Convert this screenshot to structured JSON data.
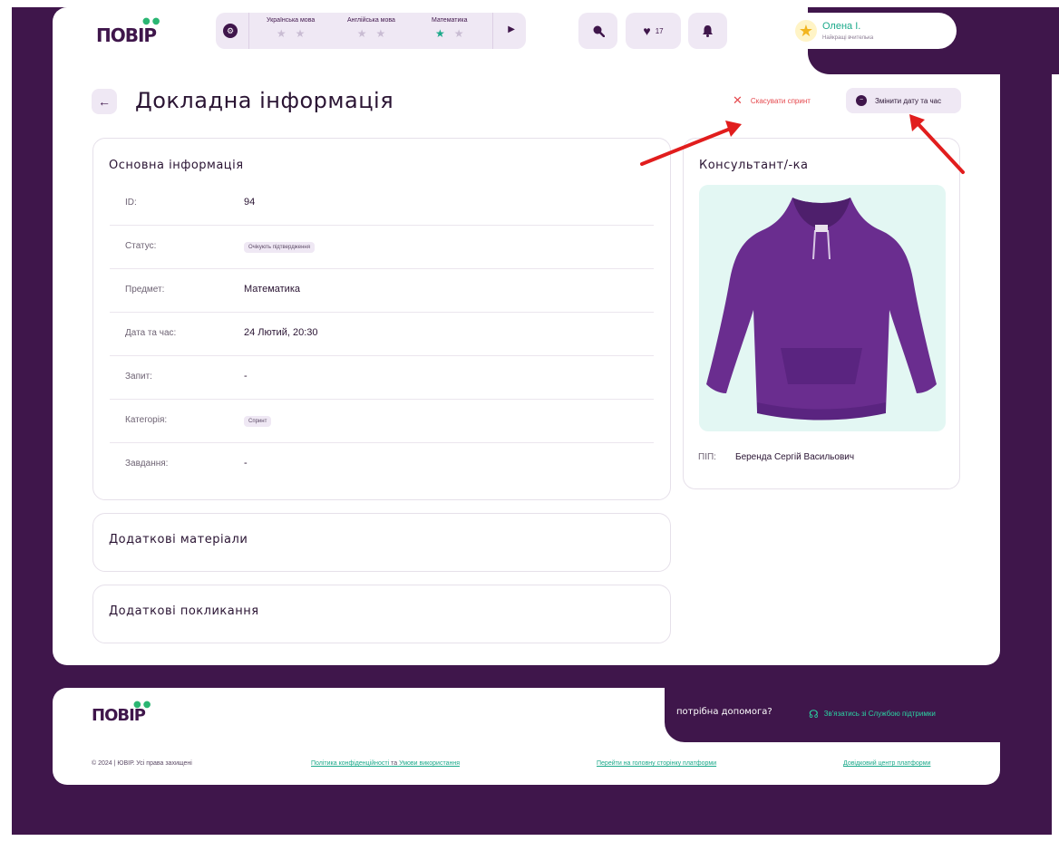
{
  "header": {
    "logo": "ПОВІР",
    "subjects": [
      {
        "name": "Українська мова",
        "stars_filled": 0
      },
      {
        "name": "Англійська мова",
        "stars_filled": 0
      },
      {
        "name": "Математика",
        "stars_filled": 1
      }
    ],
    "favorites_count": "17",
    "user": {
      "name": "Олена І.",
      "role": "Найкращі вчителька"
    }
  },
  "page": {
    "title": "Докладна інформація",
    "cancel_label": "Скасувати спринт",
    "change_label": "Змінити дату та час"
  },
  "basic_info": {
    "title": "Основна інформація",
    "rows": [
      {
        "label": "ID:",
        "value": "94"
      },
      {
        "label": "Статус:",
        "value": "Очікують підтвердження"
      },
      {
        "label": "Предмет:",
        "value": "Математика"
      },
      {
        "label": "Дата та час:",
        "value": "24 Лютий, 20:30"
      },
      {
        "label": "Запит:",
        "value": "-"
      },
      {
        "label": "Категорія:",
        "value": "Спринт"
      },
      {
        "label": "Завдання:",
        "value": "-"
      }
    ]
  },
  "materials": {
    "title": "Додаткові матеріали"
  },
  "links": {
    "title": "Додаткові покликання"
  },
  "consultant": {
    "title": "Консультант/-ка",
    "fio_label": "ПІП:",
    "fio_value": "Беренда Сергій Васильович"
  },
  "footer": {
    "logo": "ПОВІР",
    "help": "потрібна допомога?",
    "support": "Зв'язатись зі Службою підтримки",
    "copyright": "© 2024 | ЮВІР. Усі права захищені",
    "privacy": "Політика конфіденційності",
    "and": "та",
    "terms": "Умови використання",
    "home": "Перейти на головну сторінку платформи",
    "help_center": "Довідковий центр платформи"
  },
  "colors": {
    "brand": "#3f164b",
    "accent": "#1ba98a",
    "danger": "#e5484d"
  }
}
